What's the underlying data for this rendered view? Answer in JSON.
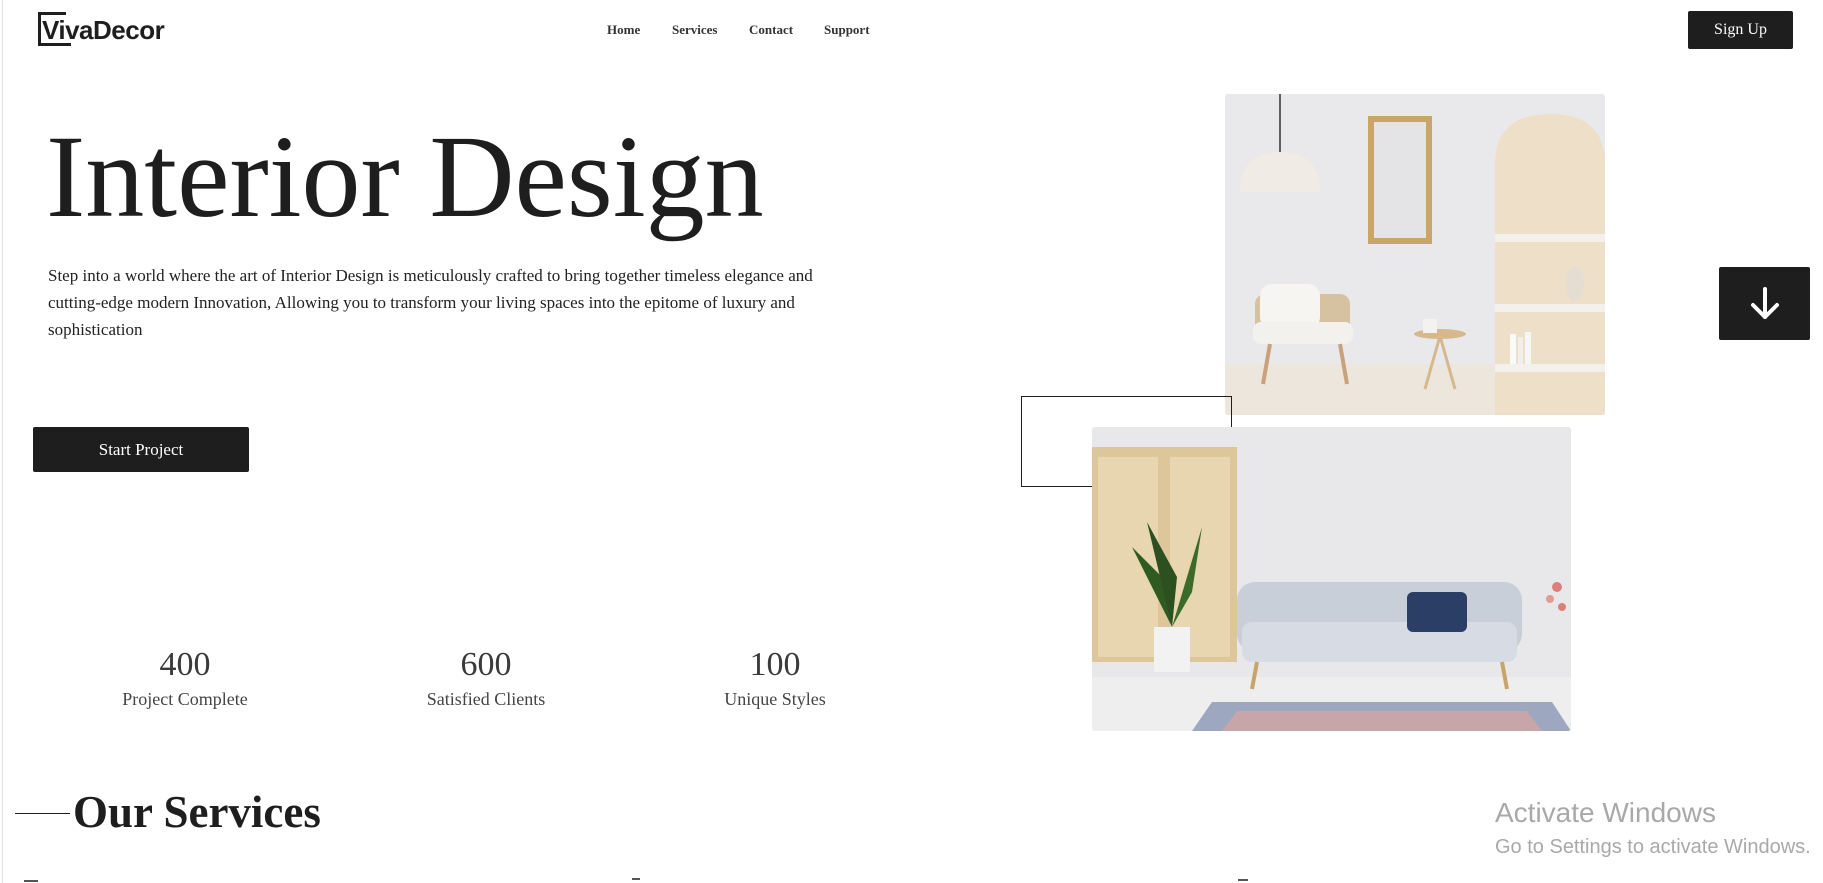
{
  "header": {
    "logo_text": "VivaDecor",
    "nav": [
      {
        "label": "Home"
      },
      {
        "label": "Services"
      },
      {
        "label": "Contact"
      },
      {
        "label": "Support"
      }
    ],
    "signup_label": "Sign Up"
  },
  "hero": {
    "title": "Interior Design",
    "description": "Step into a world where the art of Interior Design is meticulously crafted to bring together timeless elegance and cutting-edge modern Innovation, Allowing you to transform your living spaces into the epitome of luxury and sophistication",
    "cta_label": "Start Project"
  },
  "stats": [
    {
      "value": "400",
      "label": "Project Complete"
    },
    {
      "value": "600",
      "label": "Satisfied Clients"
    },
    {
      "value": "100",
      "label": "Unique Styles"
    }
  ],
  "images": {
    "top": {
      "icon": "armchair-room-photo"
    },
    "bottom": {
      "icon": "sofa-room-photo"
    }
  },
  "scroll_button": {
    "icon": "arrow-down-icon"
  },
  "services": {
    "title": "Our Services"
  },
  "watermark": {
    "title": "Activate Windows",
    "subtitle": "Go to Settings to activate Windows."
  },
  "colors": {
    "primary": "#1e1e1e",
    "background": "#ffffff",
    "watermark": "#a9a9a9"
  }
}
